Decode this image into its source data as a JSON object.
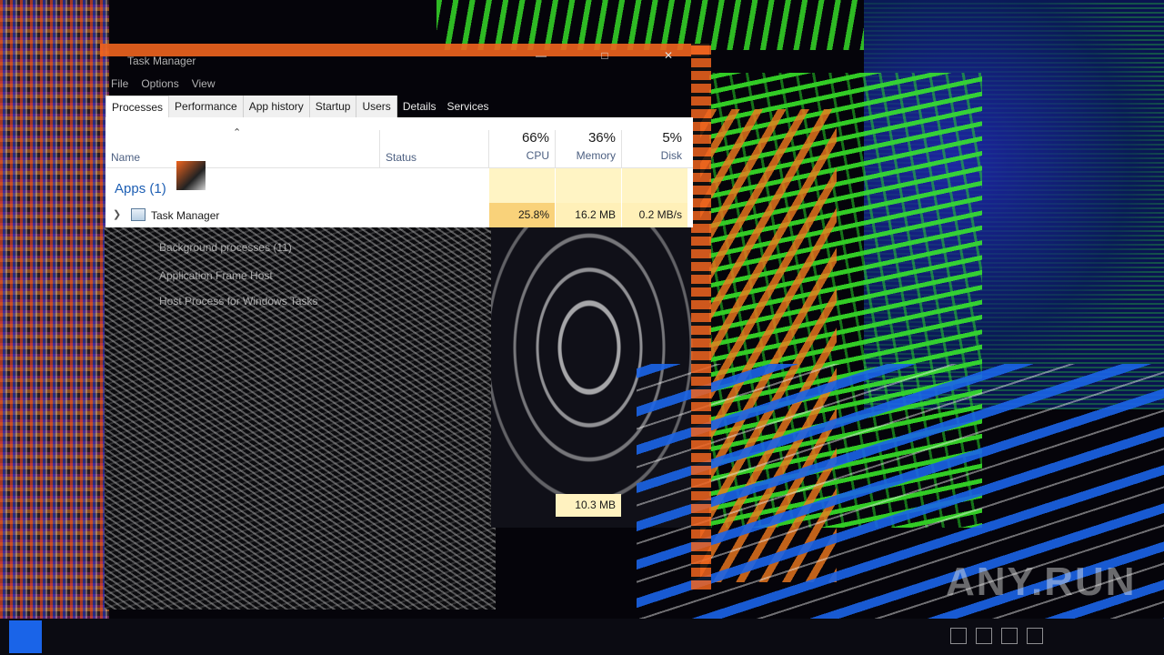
{
  "window": {
    "title": "Task Manager",
    "menu": [
      "File",
      "Options",
      "View"
    ],
    "controls": [
      "minimize",
      "maximize",
      "close"
    ]
  },
  "tabs": [
    "Processes",
    "Performance",
    "App history",
    "Startup",
    "Users",
    "Details",
    "Services"
  ],
  "active_tab": "Processes",
  "columns": {
    "name": "Name",
    "status": "Status",
    "cpu": {
      "percent": "66%",
      "label": "CPU"
    },
    "memory": {
      "percent": "36%",
      "label": "Memory"
    },
    "disk": {
      "percent": "5%",
      "label": "Disk"
    }
  },
  "groups": [
    {
      "label": "Apps (1)",
      "rows": [
        {
          "name": "Task Manager",
          "status": "",
          "cpu": "25.8%",
          "memory": "16.2 MB",
          "disk": "0.2 MB/s"
        }
      ]
    }
  ],
  "ghost_text": {
    "background_processes": "Background processes (11)",
    "frame_host": "Application Frame Host",
    "tasks": "Host Process for Windows Tasks",
    "memory_value": "10.3 MB"
  },
  "watermark": "ANY.RUN",
  "colors": {
    "accent_blue": "#1e5fb4",
    "heat_light": "#fff4c4",
    "heat_strong": "#f9d27a"
  },
  "icons": {
    "sort": "chevron-up",
    "expand": "chevron-right",
    "process": "task-manager-icon"
  }
}
